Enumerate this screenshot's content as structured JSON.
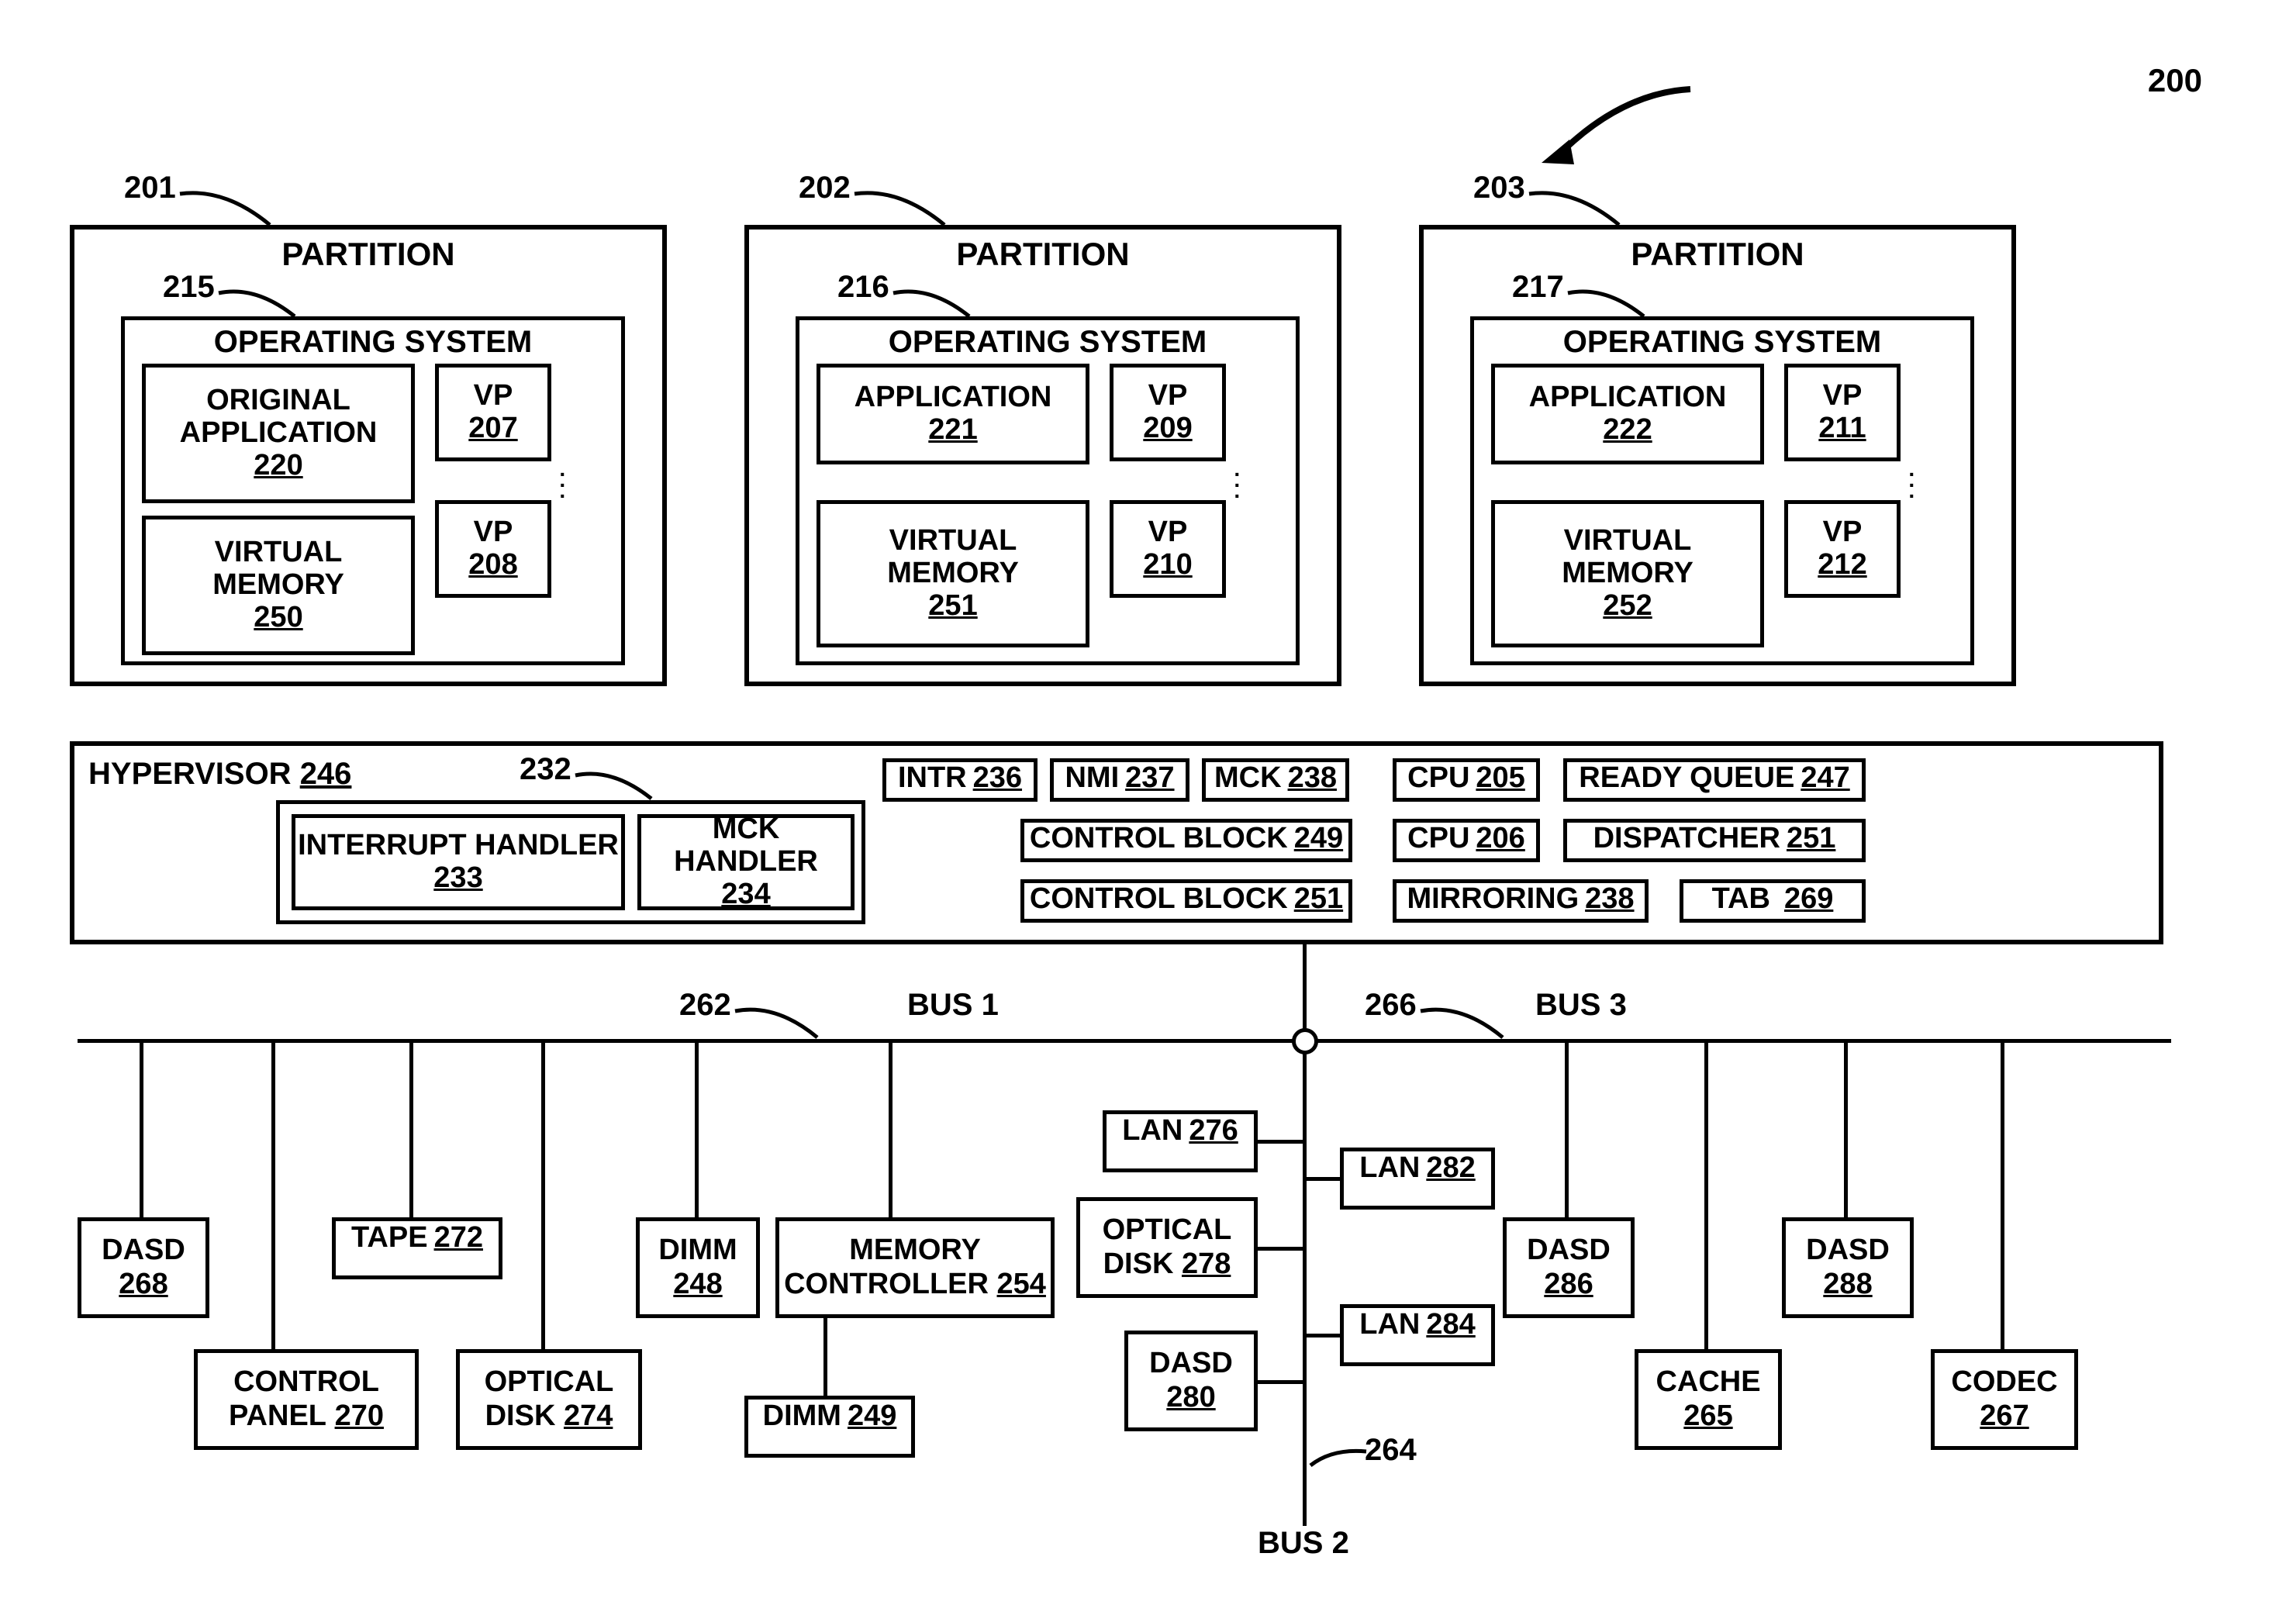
{
  "figure": "200",
  "partitions": [
    {
      "ref": "201",
      "title": "PARTITION",
      "os": {
        "ref": "215",
        "title": "OPERATING SYSTEM",
        "app": {
          "label1": "ORIGINAL",
          "label2": "APPLICATION",
          "ref": "220"
        },
        "vm": {
          "label1": "VIRTUAL",
          "label2": "MEMORY",
          "ref": "250"
        },
        "vp1": {
          "label": "VP",
          "ref": "207"
        },
        "vp2": {
          "label": "VP",
          "ref": "208"
        }
      }
    },
    {
      "ref": "202",
      "title": "PARTITION",
      "os": {
        "ref": "216",
        "title": "OPERATING SYSTEM",
        "app": {
          "label1": "APPLICATION",
          "label2": "",
          "ref": "221"
        },
        "vm": {
          "label1": "VIRTUAL",
          "label2": "MEMORY",
          "ref": "251"
        },
        "vp1": {
          "label": "VP",
          "ref": "209"
        },
        "vp2": {
          "label": "VP",
          "ref": "210"
        }
      }
    },
    {
      "ref": "203",
      "title": "PARTITION",
      "os": {
        "ref": "217",
        "title": "OPERATING SYSTEM",
        "app": {
          "label1": "APPLICATION",
          "label2": "",
          "ref": "222"
        },
        "vm": {
          "label1": "VIRTUAL",
          "label2": "MEMORY",
          "ref": "252"
        },
        "vp1": {
          "label": "VP",
          "ref": "211"
        },
        "vp2": {
          "label": "VP",
          "ref": "212"
        }
      }
    }
  ],
  "hypervisor": {
    "title": "HYPERVISOR",
    "ref": "246",
    "wrapper_ref": "232",
    "ih": {
      "label": "INTERRUPT HANDLER",
      "ref": "233"
    },
    "mh": {
      "label": "MCK HANDLER",
      "ref": "234"
    },
    "intr": {
      "label": "INTR",
      "ref": "236"
    },
    "nmi": {
      "label": "NMI",
      "ref": "237"
    },
    "mck": {
      "label": "MCK",
      "ref": "238"
    },
    "cb1": {
      "label": "CONTROL BLOCK",
      "ref": "249"
    },
    "cb2": {
      "label": "CONTROL BLOCK",
      "ref": "251"
    },
    "cpu1": {
      "label": "CPU",
      "ref": "205"
    },
    "cpu2": {
      "label": "CPU",
      "ref": "206"
    },
    "rq": {
      "label": "READY QUEUE",
      "ref": "247"
    },
    "disp": {
      "label": "DISPATCHER",
      "ref": "251"
    },
    "mirr": {
      "label": "MIRRORING",
      "ref": "238"
    },
    "tab": {
      "label": "TAB",
      "ref": "269"
    }
  },
  "buses": {
    "bus1": {
      "label": "BUS 1",
      "ref": "262"
    },
    "bus2": {
      "label": "BUS 2",
      "ref": "264"
    },
    "bus3": {
      "label": "BUS 3",
      "ref": "266"
    }
  },
  "devices": {
    "dasd268": {
      "label": "DASD",
      "ref": "268"
    },
    "cpanel": {
      "label1": "CONTROL",
      "label2": "PANEL",
      "ref": "270"
    },
    "tape": {
      "label": "TAPE",
      "ref": "272"
    },
    "odisk274": {
      "label1": "OPTICAL",
      "label2": "DISK",
      "ref": "274"
    },
    "dimm248": {
      "label": "DIMM",
      "ref": "248"
    },
    "dimm249": {
      "label": "DIMM",
      "ref": "249"
    },
    "memctrl": {
      "label1": "MEMORY",
      "label2": "CONTROLLER",
      "ref": "254"
    },
    "lan276": {
      "label": "LAN",
      "ref": "276"
    },
    "odisk278": {
      "label1": "OPTICAL",
      "label2": "DISK",
      "ref": "278"
    },
    "dasd280": {
      "label": "DASD",
      "ref": "280"
    },
    "lan282": {
      "label": "LAN",
      "ref": "282"
    },
    "lan284": {
      "label": "LAN",
      "ref": "284"
    },
    "dasd286": {
      "label": "DASD",
      "ref": "286"
    },
    "cache": {
      "label": "CACHE",
      "ref": "265"
    },
    "dasd288": {
      "label": "DASD",
      "ref": "288"
    },
    "codec": {
      "label": "CODEC",
      "ref": "267"
    }
  }
}
